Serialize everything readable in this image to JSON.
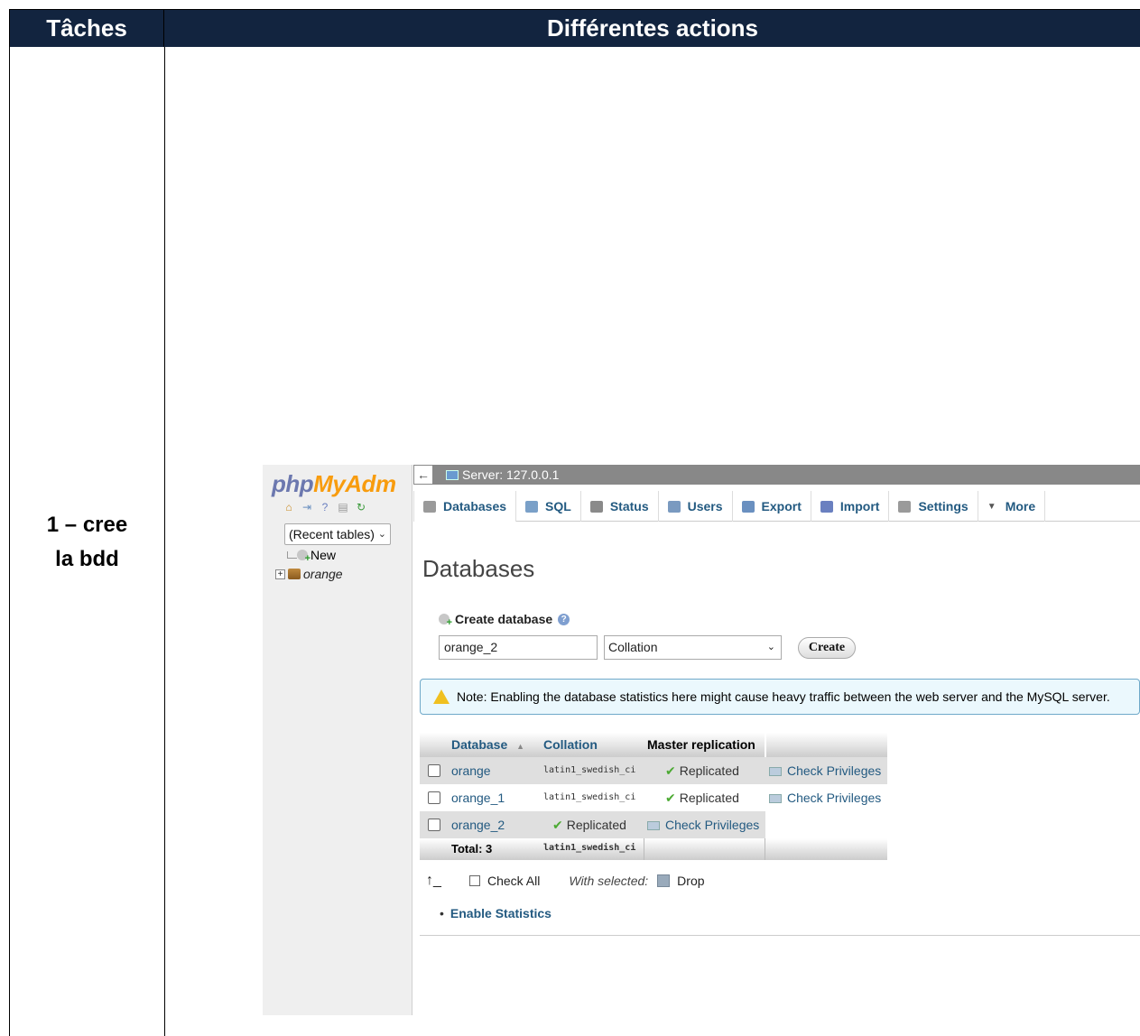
{
  "document": {
    "header_col1": "Tâches",
    "header_col2": "Différentes actions",
    "task_label": "1 – cree\nla bdd"
  },
  "pma": {
    "logo": {
      "php": "php",
      "my": "My",
      "adm": "Adm"
    },
    "nav": {
      "recent_tables": "(Recent tables)",
      "new_label": "New",
      "db_item": "orange"
    },
    "topbar": {
      "back": "←",
      "server": "Server: 127.0.0.1"
    },
    "tabs": [
      {
        "label": "Databases",
        "icon": "database-icon",
        "color": "#9a9a9a"
      },
      {
        "label": "SQL",
        "icon": "sql-icon",
        "color": "#7aa0c8"
      },
      {
        "label": "Status",
        "icon": "status-icon",
        "color": "#8a8a8a"
      },
      {
        "label": "Users",
        "icon": "users-icon",
        "color": "#7a9ac0"
      },
      {
        "label": "Export",
        "icon": "export-icon",
        "color": "#6a90c0"
      },
      {
        "label": "Import",
        "icon": "import-icon",
        "color": "#6a80c0"
      },
      {
        "label": "Settings",
        "icon": "wrench-icon",
        "color": "#9a9a9a"
      },
      {
        "label": "More",
        "icon": "triangle-down-icon",
        "color": "#555555"
      }
    ],
    "page_title": "Databases",
    "create": {
      "label": "Create database",
      "input_value": "orange_2",
      "collation_placeholder": "Collation",
      "button": "Create"
    },
    "note": "Note: Enabling the database statistics here might cause heavy traffic between the web server and the MySQL server.",
    "table": {
      "headers": {
        "database": "Database",
        "collation": "Collation",
        "replication": "Master replication"
      },
      "rows": [
        {
          "name": "orange",
          "collation": "latin1_swedish_ci",
          "replication": "Replicated",
          "action": "Check Privileges"
        },
        {
          "name": "orange_1",
          "collation": "latin1_swedish_ci",
          "replication": "Replicated",
          "action": "Check Privileges"
        },
        {
          "name": "orange_2",
          "collation": "",
          "replication": "Replicated",
          "action": "Check Privileges"
        }
      ],
      "total_label": "Total: 3",
      "total_collation": "latin1_swedish_ci"
    },
    "actions": {
      "check_all": "Check All",
      "with_selected": "With selected:",
      "drop": "Drop",
      "enable_statistics": "Enable Statistics"
    },
    "colors": {
      "header_bg": "#12243f",
      "link": "#235a81",
      "logo_php": "#6c78af",
      "logo_my": "#f89c0e"
    }
  }
}
